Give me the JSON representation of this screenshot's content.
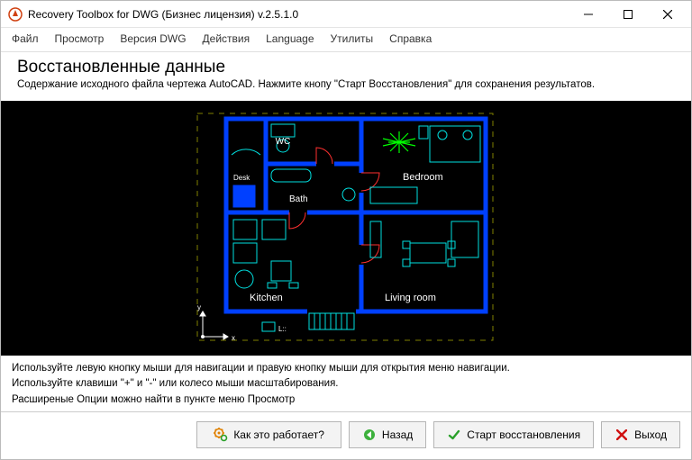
{
  "window": {
    "title": "Recovery Toolbox for DWG (Бизнес лицензия) v.2.5.1.0"
  },
  "menu": {
    "items": [
      "Файл",
      "Просмотр",
      "Версия DWG",
      "Действия",
      "Language",
      "Утилиты",
      "Справка"
    ]
  },
  "header": {
    "title": "Восстановленные данные",
    "subtitle": "Содержание исходного файла чертежа AutoCAD. Нажмите кнопу \"Старт Восстановления\" для сохранения результатов."
  },
  "drawing": {
    "axis_x": "x",
    "axis_y": "y",
    "rooms": {
      "wc": "WC",
      "bath": "Bath",
      "bedroom": "Bedroom",
      "kitchen": "Kitchen",
      "living": "Living room"
    },
    "label_desk": "Desk",
    "label_l": "L::"
  },
  "hints": {
    "line1": "Используйте левую кнопку мыши для навигации и правую кнопку мыши для открытия меню навигации.",
    "line2": "Используйте клавиши \"+\" и \"-\" или колесо мыши масштабирования.",
    "line3": "Расширеные Опции можно найти в пункте меню Просмотр"
  },
  "buttons": {
    "how": "Как это работает?",
    "back": "Назад",
    "start": "Старт восстановления",
    "exit": "Выход"
  },
  "colors": {
    "cad_wall": "#0040ff",
    "cad_furn": "#00e0e0",
    "cad_door": "#ff3030",
    "cad_plant": "#00ff00",
    "cad_text": "#ffffff",
    "cad_bound": "#808000"
  }
}
